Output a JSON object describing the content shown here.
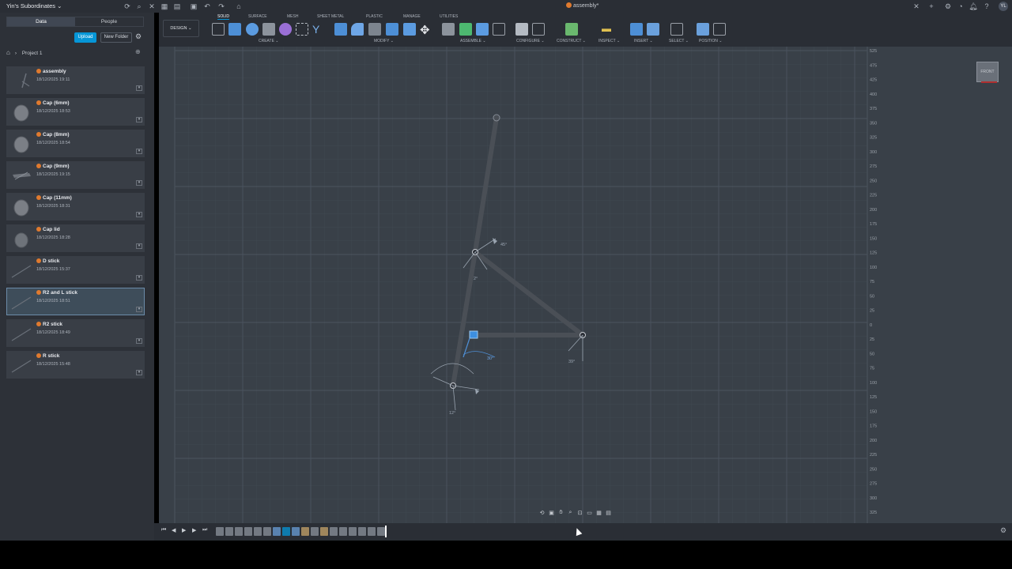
{
  "titlebar": {
    "team_name": "Yin's Subordinates",
    "document_title": "assembly*",
    "avatar_initials": "YL"
  },
  "left_panel": {
    "tabs": [
      {
        "label": "Data",
        "active": true
      },
      {
        "label": "People",
        "active": false
      }
    ],
    "upload_label": "Upload",
    "new_folder_label": "New Folder",
    "breadcrumb": "Project 1",
    "files": [
      {
        "name": "assembly",
        "date": "18/12/2025 19:11",
        "thumb": "linkage"
      },
      {
        "name": "Cap (6mm)",
        "date": "18/12/2025 18:53",
        "thumb": "cap"
      },
      {
        "name": "Cap (8mm)",
        "date": "18/12/2025 18:54",
        "thumb": "cap"
      },
      {
        "name": "Cap (9mm)",
        "date": "18/12/2025 19:15",
        "thumb": "sheet"
      },
      {
        "name": "Cap (11mm)",
        "date": "18/12/2025 18:31",
        "thumb": "cap"
      },
      {
        "name": "Cap lid",
        "date": "18/12/2025 18:28",
        "thumb": "lid"
      },
      {
        "name": "D stick",
        "date": "18/12/2025 15:37",
        "thumb": "stick"
      },
      {
        "name": "R2 and L stick",
        "date": "18/12/2025 18:51",
        "thumb": "stick",
        "selected": true
      },
      {
        "name": "R2 stick",
        "date": "18/12/2025 18:49",
        "thumb": "stick"
      },
      {
        "name": "R stick",
        "date": "18/12/2025 15:48",
        "thumb": "stick"
      }
    ]
  },
  "toolbar": {
    "workspace": "DESIGN",
    "tabs": [
      "SOLID",
      "SURFACE",
      "MESH",
      "SHEET METAL",
      "PLASTIC",
      "MANAGE",
      "UTILITIES"
    ],
    "active_tab": "SOLID",
    "groups": [
      "CREATE",
      "MODIFY",
      "ASSEMBLE",
      "CONFIGURE",
      "CONSTRUCT",
      "INSPECT",
      "INSERT",
      "SELECT",
      "POSITION"
    ]
  },
  "canvas": {
    "viewcube_label": "FRONT",
    "ruler_ticks": [
      "525",
      "475",
      "425",
      "400",
      "375",
      "350",
      "325",
      "300",
      "275",
      "250",
      "225",
      "200",
      "175",
      "150",
      "125",
      "100",
      "75",
      "50",
      "25",
      "0",
      "25",
      "50",
      "75",
      "100",
      "125",
      "150",
      "175",
      "200",
      "225",
      "250",
      "275",
      "300",
      "325"
    ],
    "dim_labels": [
      "45°",
      "2°",
      "30°",
      "39°",
      "12°"
    ]
  },
  "colors": {
    "accent": "#0696d7",
    "brand_orange": "#e07a2e",
    "canvas_bg": "#394048",
    "panel_bg": "#2d3138"
  }
}
